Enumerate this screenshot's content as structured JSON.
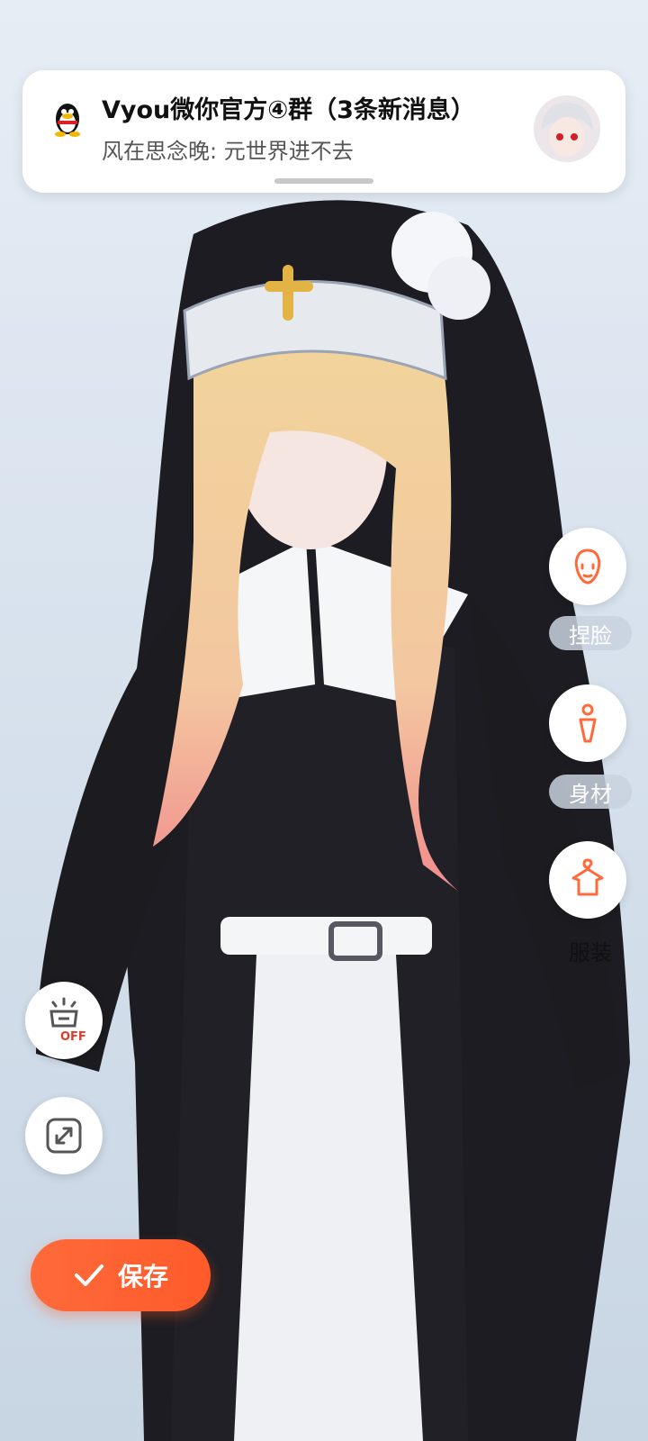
{
  "notification": {
    "title": "Vyou微你官方④群（3条新消息）",
    "message": "风在思念晚: 元世界进不去",
    "app_icon": "qq-penguin-icon",
    "avatar": "group-avatar"
  },
  "tools": [
    {
      "label": "捏脸",
      "icon": "face-icon"
    },
    {
      "label": "身材",
      "icon": "body-icon"
    },
    {
      "label": "服装",
      "icon": "clothes-hanger-icon"
    }
  ],
  "left_tools": [
    {
      "icon": "light-off-icon",
      "badge": "OFF"
    },
    {
      "icon": "expand-icon"
    }
  ],
  "save": {
    "label": "保存",
    "icon": "check-icon"
  },
  "colors": {
    "accent": "#ff5a2a",
    "tool_icon": "#ff6a3a"
  }
}
